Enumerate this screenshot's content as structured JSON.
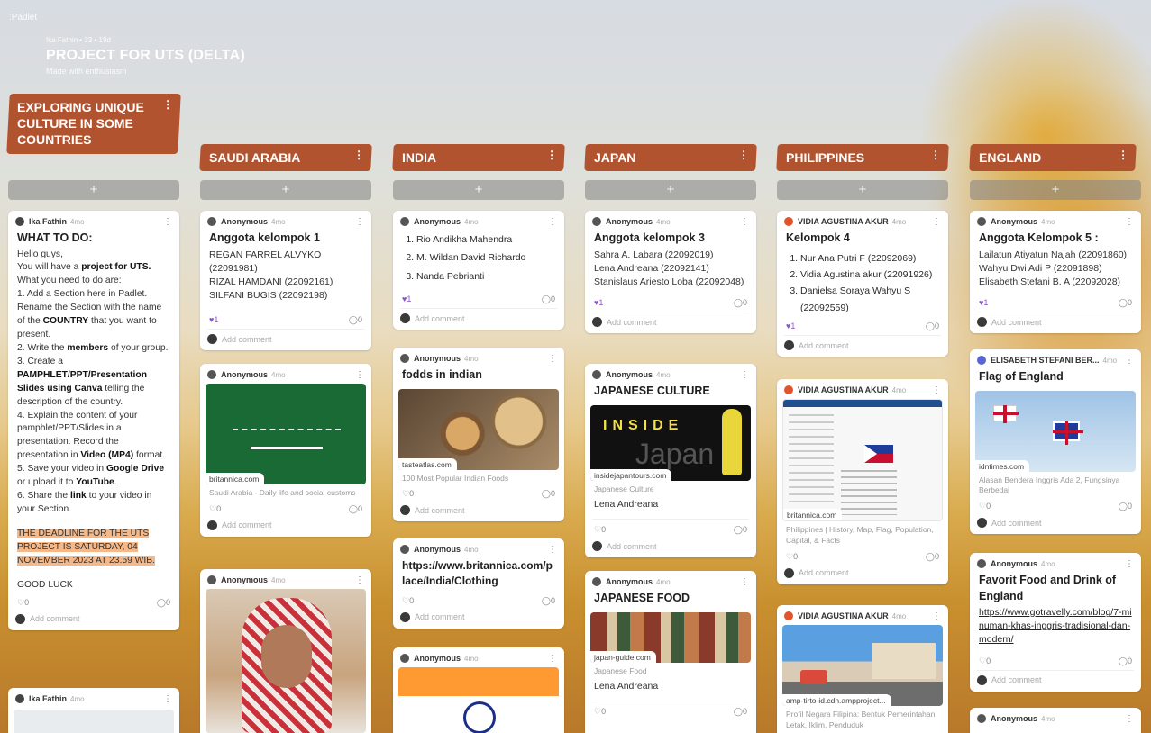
{
  "app": {
    "name": ":Padlet"
  },
  "board": {
    "meta": "Ika Fathin • 33 • 19d",
    "title": "PROJECT FOR UTS (DELTA)",
    "subtitle": "Made with enthusiasm"
  },
  "icons": {
    "menu": "kebab-vertical-icon",
    "add": "plus-icon",
    "like": "heart-icon",
    "comment": "comment-bubble-icon"
  },
  "colors": {
    "section": "#b2532f",
    "heart": "#8b52d1",
    "highlight": "#f5b889"
  },
  "sections": [
    {
      "name": "EXPLORING UNIQUE CULTURE IN SOME COUNTRIES",
      "add": "+",
      "cards": [
        {
          "author": "Ika Fathin",
          "ago": "4mo",
          "title": "WHAT TO DO:",
          "lines": {
            "l1": "Hello guys,",
            "l2a": "You will have a ",
            "l2b": "project for UTS.",
            "l3": "What you need to do are:",
            "l4a": "1. Add a Section here in Padlet. Rename the Section with the name of the ",
            "l4b": "COUNTRY",
            "l4c": " that you want to present.",
            "l5a": "2. Write the ",
            "l5b": "members",
            "l5c": " of your group.",
            "l6a": "3. Create a ",
            "l6b": "PAMPHLET/PPT/Presentation Slides using Canva",
            "l6c": " telling the description of the country.",
            "l7a": "4. Explain the content of your pamphlet/PPT/Slides in a presentation. Record the presentation in ",
            "l7b": "Video (MP4)",
            "l7c": " format.",
            "l8a": "5. Save your video in ",
            "l8b": "Google Drive",
            "l8c": " or upload it to ",
            "l8d": "YouTube",
            "l8e": ".",
            "l9a": "6. Share the ",
            "l9b": "link",
            "l9c": " to your video in your Section.",
            "deadline": "THE DEADLINE FOR THE UTS PROJECT IS SATURDAY, 04 NOVEMBER 2023 AT 23.59 WIB.",
            "luck": "GOOD LUCK"
          },
          "likes": "0",
          "comments": "0",
          "add_comment": "Add comment"
        },
        {
          "author": "Ika Fathin",
          "ago": "4mo"
        }
      ]
    },
    {
      "name": "SAUDI ARABIA",
      "add": "+",
      "cards": [
        {
          "author": "Anonymous",
          "ago": "4mo",
          "title": "Anggota kelompok 1",
          "body": [
            "REGAN FARREL ALVYKO (22091981)",
            "RIZAL HAMDANI (22092161)",
            "SILFANI BUGIS (22092198)"
          ],
          "likes": "1",
          "comments": "0",
          "add_comment": "Add comment"
        },
        {
          "author": "Anonymous",
          "ago": "4mo",
          "image_label": "britannica.com",
          "caption": "Saudi Arabia - Daily life and social customs",
          "likes": "0",
          "comments": "0",
          "add_comment": "Add comment"
        },
        {
          "author": "Anonymous",
          "ago": "4mo"
        }
      ]
    },
    {
      "name": "INDIA",
      "add": "+",
      "cards": [
        {
          "author": "Anonymous",
          "ago": "4mo",
          "list": [
            "Rio Andikha Mahendra",
            "M. Wildan David Richardo",
            "Nanda Pebrianti"
          ],
          "likes": "1",
          "comments": "0",
          "add_comment": "Add comment"
        },
        {
          "author": "Anonymous",
          "ago": "4mo",
          "title": "fodds in indian",
          "image_label": "tasteatlas.com",
          "caption": "100 Most Popular Indian Foods",
          "likes": "0",
          "comments": "0",
          "add_comment": "Add comment"
        },
        {
          "author": "Anonymous",
          "ago": "4mo",
          "title": "https://www.britannica.com/place/India/Clothing",
          "likes": "0",
          "comments": "0",
          "add_comment": "Add comment"
        },
        {
          "author": "Anonymous",
          "ago": "4mo"
        }
      ]
    },
    {
      "name": "JAPAN",
      "add": "+",
      "cards": [
        {
          "author": "Anonymous",
          "ago": "4mo",
          "title": "Anggota kelompok 3",
          "body": [
            "Sahra A. Labara (22092019)",
            "Lena Andreana (22092141)",
            "Stanislaus Ariesto Loba (22092048)"
          ],
          "likes": "1",
          "comments": "0",
          "add_comment": "Add comment"
        },
        {
          "author": "Anonymous",
          "ago": "4mo",
          "title": "JAPANESE CULTURE",
          "image_text": "INSIDE",
          "image_text2": "Japan",
          "image_label": "insidejapantours.com",
          "caption": "Japanese Culture",
          "note": "Lena Andreana",
          "likes": "0",
          "comments": "0",
          "add_comment": "Add comment"
        },
        {
          "author": "Anonymous",
          "ago": "4mo",
          "title": "JAPANESE FOOD",
          "image_label": "japan-guide.com",
          "caption": "Japanese Food",
          "note": "Lena Andreana",
          "likes": "0",
          "comments": "0"
        }
      ]
    },
    {
      "name": "PHILIPPINES",
      "add": "+",
      "cards": [
        {
          "author": "VIDIA AGUSTINA AKUR",
          "ago": "4mo",
          "title": "Kelompok 4",
          "list": [
            "Nur Ana Putri F (22092069)",
            "Vidia Agustina akur (22091926)",
            "Danielsa Soraya Wahyu S (22092559)"
          ],
          "likes": "1",
          "comments": "0",
          "add_comment": "Add comment"
        },
        {
          "author": "VIDIA AGUSTINA AKUR",
          "ago": "4mo",
          "image_label": "britannica.com",
          "caption": "Philippines | History, Map, Flag, Population, Capital, & Facts",
          "likes": "0",
          "comments": "0",
          "add_comment": "Add comment"
        },
        {
          "author": "VIDIA AGUSTINA AKUR",
          "ago": "4mo",
          "image_label": "amp-tirto-id.cdn.ampproject...",
          "caption": "Profil Negara Filipina: Bentuk Pemerintahan, Letak, Iklim, Penduduk"
        }
      ]
    },
    {
      "name": "ENGLAND",
      "add": "+",
      "cards": [
        {
          "author": "Anonymous",
          "ago": "4mo",
          "title": "Anggota Kelompok 5 :",
          "body": [
            "Lailatun Atiyatun Najah (22091860)",
            "Wahyu Dwi Adi P (22091898)",
            "Elisabeth Stefani B. A (22092028)"
          ],
          "likes": "1",
          "comments": "0",
          "add_comment": "Add comment"
        },
        {
          "author": "ELISABETH STEFANI BER...",
          "ago": "4mo",
          "title": "Flag of England",
          "image_label": "idntimes.com",
          "caption": "Alasan Bendera Inggris Ada 2, Fungsinya Berbedal",
          "likes": "0",
          "comments": "0",
          "add_comment": "Add comment"
        },
        {
          "author": "Anonymous",
          "ago": "4mo",
          "title": "Favorit Food and Drink of England",
          "link": "https://www.gotravelly.com/blog/7-minuman-khas-inggris-tradisional-dan-modern/",
          "likes": "0",
          "comments": "0",
          "add_comment": "Add comment"
        },
        {
          "author": "Anonymous",
          "ago": "4mo"
        }
      ]
    }
  ]
}
